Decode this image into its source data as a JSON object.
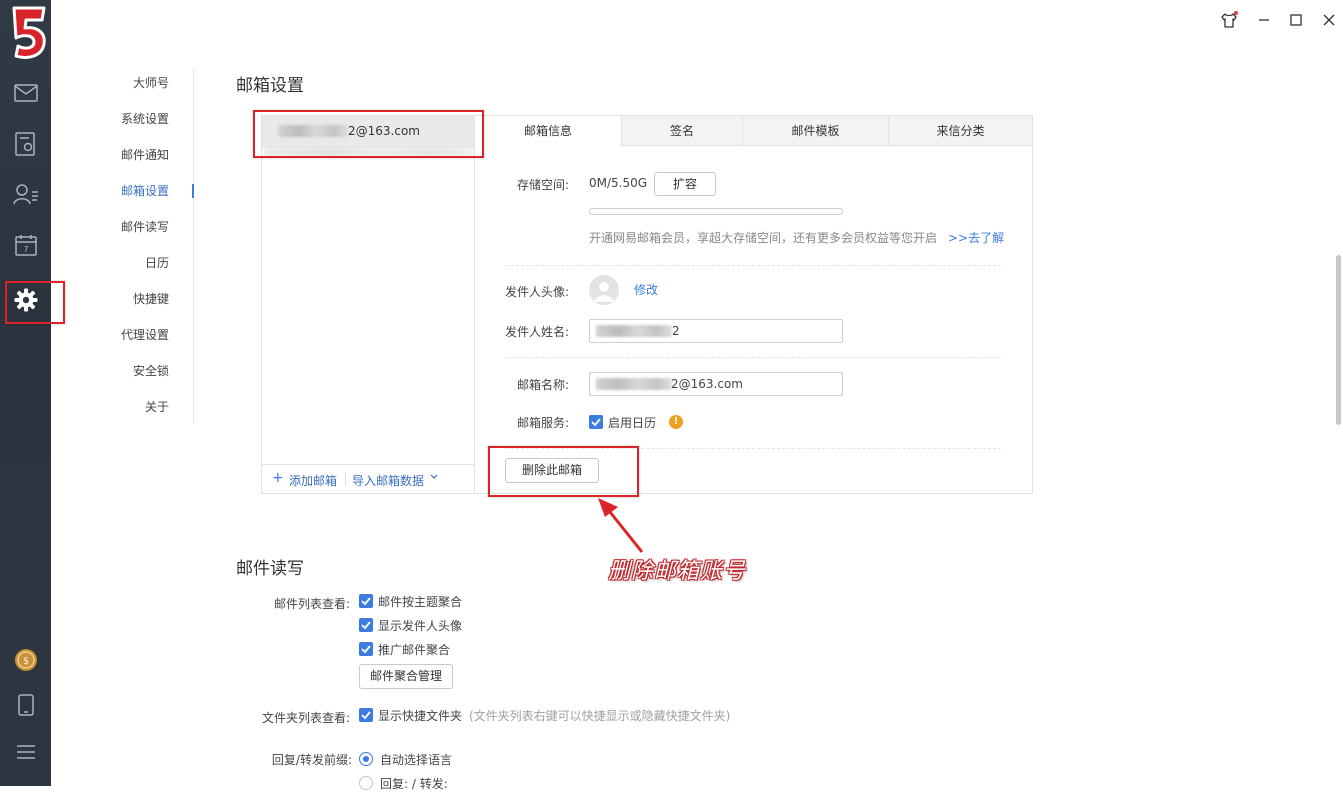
{
  "app": {
    "logo_text": "5"
  },
  "rail": {
    "icons": [
      "mail-icon",
      "contacts-card-icon",
      "contacts-icon",
      "calendar-icon",
      "settings-gear-icon",
      "coin-icon",
      "mobile-icon",
      "menu-icon"
    ],
    "calendar_day": "7"
  },
  "window_controls": [
    "skin-icon",
    "minimize-icon",
    "maximize-icon",
    "close-icon"
  ],
  "settings_nav": {
    "items": [
      "大师号",
      "系统设置",
      "邮件通知",
      "邮箱设置",
      "邮件读写",
      "日历",
      "快捷键",
      "代理设置",
      "安全锁",
      "关于"
    ],
    "active": "邮箱设置"
  },
  "mailbox_settings": {
    "title": "邮箱设置",
    "account": {
      "email_suffix": "2@163.com"
    },
    "footer": {
      "add_label": "添加邮箱",
      "import_label": "导入邮箱数据"
    },
    "tabs": [
      "邮箱信息",
      "签名",
      "邮件模板",
      "来信分类"
    ],
    "active_tab": "邮箱信息",
    "storage": {
      "label": "存储空间:",
      "value": "0M/5.50G",
      "expand_button": "扩容",
      "usage_fraction": 0,
      "promo_text": "开通网易邮箱会员，享超大存储空间，还有更多会员权益等您开启",
      "promo_link": ">>去了解"
    },
    "avatar": {
      "label": "发件人头像:",
      "edit_link": "修改"
    },
    "sender_name": {
      "label": "发件人姓名:",
      "value_suffix": "2"
    },
    "mailbox_name": {
      "label": "邮箱名称:",
      "value_suffix": "2@163.com"
    },
    "service": {
      "label": "邮箱服务:",
      "calendar_label": "启用日历",
      "calendar_checked": true
    },
    "delete_button": "删除此邮箱"
  },
  "annotation": {
    "text": "删除邮箱账号"
  },
  "mail_rw": {
    "title": "邮件读写",
    "list_view": {
      "label": "邮件列表查看:",
      "options": [
        "邮件按主题聚合",
        "显示发件人头像",
        "推广邮件聚合"
      ],
      "manage_button": "邮件聚合管理"
    },
    "folder_view": {
      "label": "文件夹列表查看:",
      "option": "显示快捷文件夹",
      "hint": "(文件夹列表右键可以快捷显示或隐藏快捷文件夹)"
    },
    "reply_prefix": {
      "label": "回复/转发前缀:",
      "options": [
        "自动选择语言",
        "回复: / 转发:"
      ],
      "selected": "自动选择语言"
    }
  },
  "colors": {
    "accent": "#3c7be0",
    "rail_bg": "#2e3842",
    "highlight_red": "#d9252a"
  }
}
